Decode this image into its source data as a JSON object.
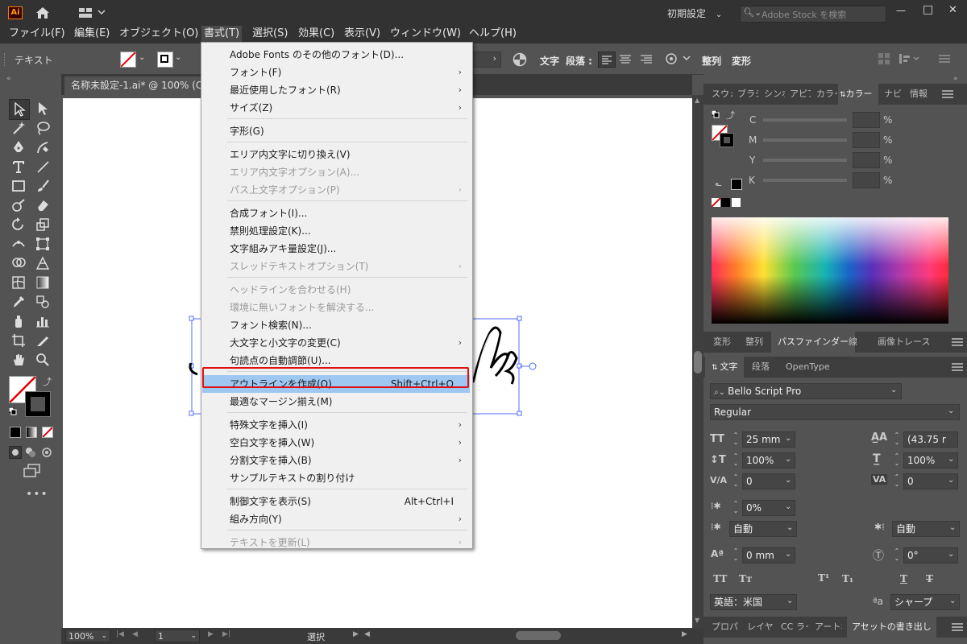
{
  "titlebar": {
    "app_icon": "Ai",
    "workspace": "初期設定",
    "search_placeholder": "Adobe Stock を検索",
    "minimize": "—",
    "maximize": "□",
    "close": "✕"
  },
  "menubar": {
    "items": [
      "ファイル(F)",
      "編集(E)",
      "オブジェクト(O)",
      "書式(T)",
      "選択(S)",
      "効果(C)",
      "表示(V)",
      "ウィンドウ(W)",
      "ヘルプ(H)"
    ]
  },
  "control": {
    "selection_type": "テキスト",
    "char_label": "文字",
    "para_label": "段落 :",
    "align_label": "整列",
    "transform_label": "変形"
  },
  "document": {
    "tab_title": "名称未設定-1.ai* @ 100% (CMYK"
  },
  "type_menu": {
    "items": [
      {
        "label": "Adobe Fonts のその他のフォント(D)...",
        "shortcut": "",
        "submenu": false,
        "disabled": false
      },
      {
        "label": "フォント(F)",
        "shortcut": "",
        "submenu": true,
        "disabled": false
      },
      {
        "label": "最近使用したフォント(R)",
        "shortcut": "",
        "submenu": true,
        "disabled": false
      },
      {
        "label": "サイズ(Z)",
        "shortcut": "",
        "submenu": true,
        "disabled": false
      },
      {
        "label": "字形(G)",
        "shortcut": "",
        "submenu": false,
        "disabled": false
      },
      {
        "label": "エリア内文字に切り換え(V)",
        "shortcut": "",
        "submenu": false,
        "disabled": false
      },
      {
        "label": "エリア内文字オプション(A)...",
        "shortcut": "",
        "submenu": false,
        "disabled": true
      },
      {
        "label": "パス上文字オプション(P)",
        "shortcut": "",
        "submenu": true,
        "disabled": true
      },
      {
        "label": "合成フォント(I)...",
        "shortcut": "",
        "submenu": false,
        "disabled": false
      },
      {
        "label": "禁則処理設定(K)...",
        "shortcut": "",
        "submenu": false,
        "disabled": false
      },
      {
        "label": "文字組みアキ量設定(J)...",
        "shortcut": "",
        "submenu": false,
        "disabled": false
      },
      {
        "label": "スレッドテキストオプション(T)",
        "shortcut": "",
        "submenu": true,
        "disabled": true
      },
      {
        "label": "ヘッドラインを合わせる(H)",
        "shortcut": "",
        "submenu": false,
        "disabled": true
      },
      {
        "label": "環境に無いフォントを解決する...",
        "shortcut": "",
        "submenu": false,
        "disabled": true
      },
      {
        "label": "フォント検索(N)...",
        "shortcut": "",
        "submenu": false,
        "disabled": false
      },
      {
        "label": "大文字と小文字の変更(C)",
        "shortcut": "",
        "submenu": true,
        "disabled": false
      },
      {
        "label": "句読点の自動調節(U)...",
        "shortcut": "",
        "submenu": false,
        "disabled": false
      },
      {
        "label": "アウトラインを作成(O)",
        "shortcut": "Shift+Ctrl+O",
        "submenu": false,
        "disabled": false,
        "highlighted": true
      },
      {
        "label": "最適なマージン揃え(M)",
        "shortcut": "",
        "submenu": false,
        "disabled": false
      },
      {
        "label": "特殊文字を挿入(I)",
        "shortcut": "",
        "submenu": true,
        "disabled": false
      },
      {
        "label": "空白文字を挿入(W)",
        "shortcut": "",
        "submenu": true,
        "disabled": false
      },
      {
        "label": "分割文字を挿入(B)",
        "shortcut": "",
        "submenu": true,
        "disabled": false
      },
      {
        "label": "サンプルテキストの割り付け",
        "shortcut": "",
        "submenu": false,
        "disabled": false
      },
      {
        "label": "制御文字を表示(S)",
        "shortcut": "Alt+Ctrl+I",
        "submenu": false,
        "disabled": false
      },
      {
        "label": "組み方向(Y)",
        "shortcut": "",
        "submenu": true,
        "disabled": false
      },
      {
        "label": "テキストを更新(L)",
        "shortcut": "",
        "submenu": true,
        "disabled": true
      }
    ]
  },
  "color_panel": {
    "tabs": [
      "スウォ",
      "ブラシ",
      "シンボ",
      "アピア",
      "カラー",
      "カラー",
      "ナビ",
      "情報"
    ],
    "active_tab": "カラー",
    "channels": [
      {
        "name": "C",
        "value": "",
        "unit": "%"
      },
      {
        "name": "M",
        "value": "",
        "unit": "%"
      },
      {
        "name": "Y",
        "value": "",
        "unit": "%"
      },
      {
        "name": "K",
        "value": "",
        "unit": "%"
      }
    ]
  },
  "mid_panel": {
    "tabs": [
      "変形",
      "整列",
      "パスファインダー",
      "線",
      "画像トレース"
    ],
    "active_tab": "パスファインダー"
  },
  "char_panel": {
    "tabs": [
      "文字",
      "段落",
      "OpenType"
    ],
    "active_tab": "文字",
    "font_family": "Bello Script Pro",
    "font_style": "Regular",
    "font_size": "25 mm",
    "leading": "(43.75 r",
    "vert_scale": "100%",
    "horiz_scale": "100%",
    "kerning": "0",
    "tracking": "0",
    "tsume": "0%",
    "aki_left": "自動",
    "aki_right": "自動",
    "baseline_shift": "0 mm",
    "rotation": "0°",
    "language": "英語：米国",
    "antialias": "シャープ"
  },
  "bottom_tabs": [
    "プロパ",
    "レイヤ",
    "CC ライ",
    "アートボ",
    "アセットの書き出し"
  ],
  "status": {
    "zoom": "100%",
    "artboard_num": "1",
    "tool_name": "選択"
  }
}
